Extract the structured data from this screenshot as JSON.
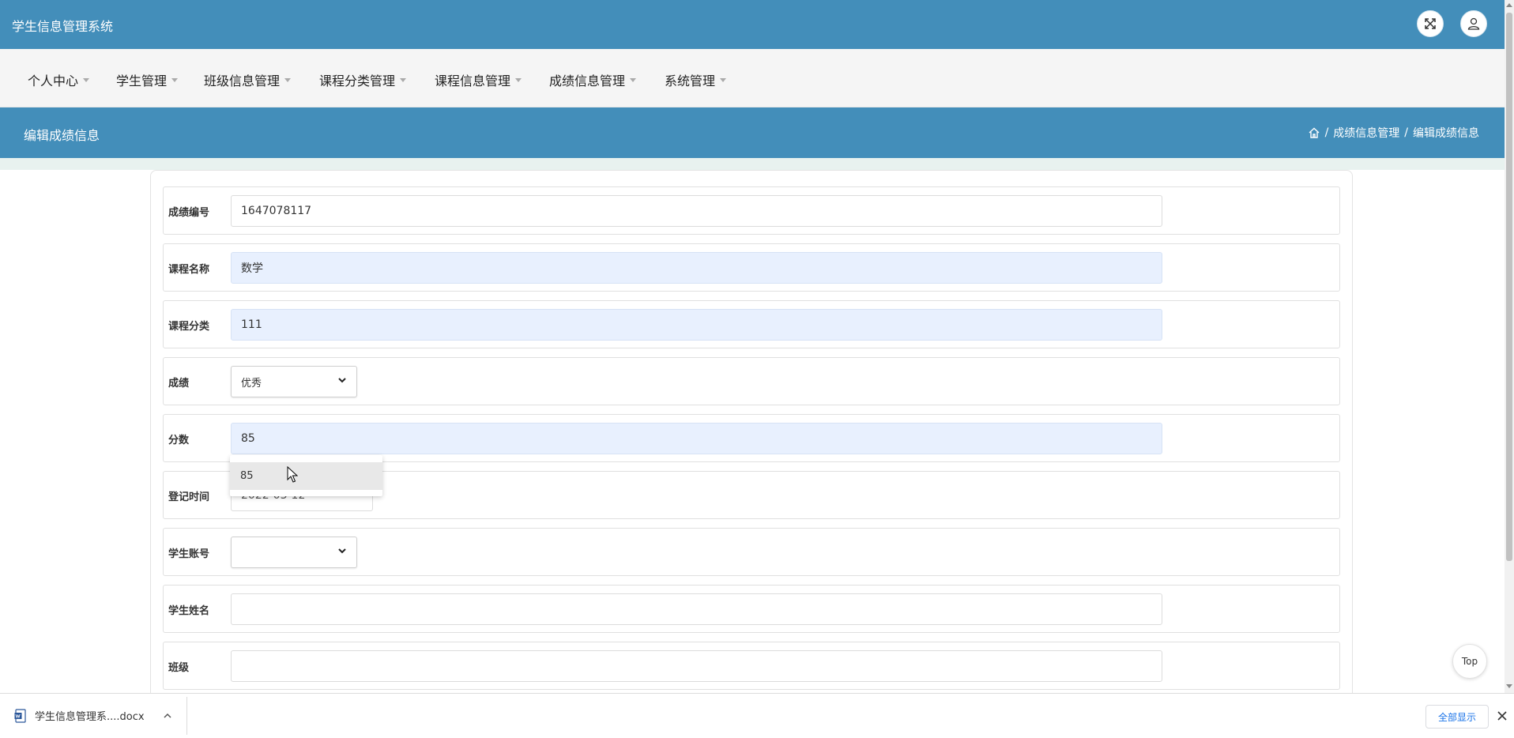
{
  "header": {
    "app_title": "学生信息管理系统"
  },
  "nav": {
    "items": [
      "个人中心",
      "学生管理",
      "班级信息管理",
      "课程分类管理",
      "课程信息管理",
      "成绩信息管理",
      "系统管理"
    ]
  },
  "titlebar": {
    "page_title": "编辑成绩信息",
    "breadcrumb": [
      "成绩信息管理",
      "编辑成绩信息"
    ]
  },
  "form": {
    "score_id": {
      "label": "成绩编号",
      "value": "1647078117"
    },
    "course_name": {
      "label": "课程名称",
      "value": "数学"
    },
    "course_category": {
      "label": "课程分类",
      "value": "111"
    },
    "grade": {
      "label": "成绩",
      "value": "优秀"
    },
    "score": {
      "label": "分数",
      "value": "85"
    },
    "register_time": {
      "label": "登记时间",
      "value": "2022-03-12"
    },
    "student_account": {
      "label": "学生账号",
      "value": ""
    },
    "student_name": {
      "label": "学生姓名",
      "value": ""
    },
    "class": {
      "label": "班级",
      "value": ""
    }
  },
  "autocomplete": {
    "suggestion": "85"
  },
  "top_button": "Top",
  "downloads": {
    "filename": "学生信息管理系....docx",
    "show_all": "全部显示"
  }
}
